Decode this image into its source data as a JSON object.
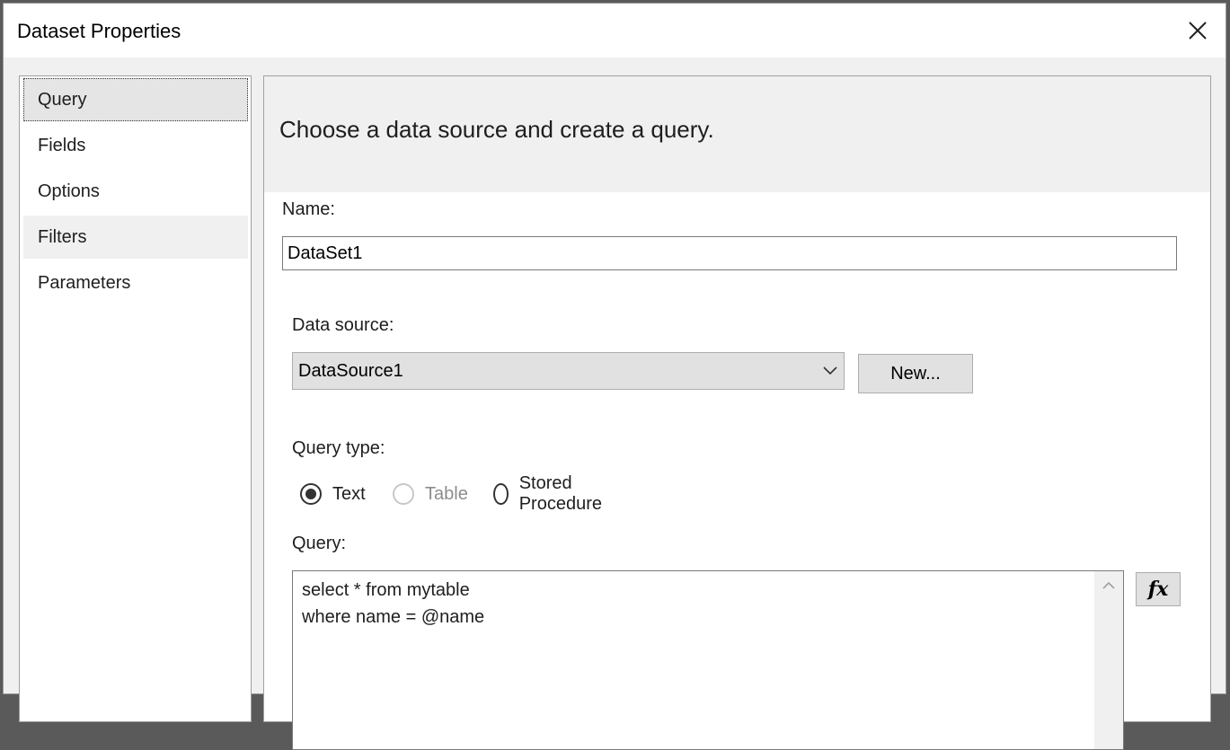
{
  "window": {
    "title": "Dataset Properties"
  },
  "nav": {
    "items": [
      {
        "label": "Query"
      },
      {
        "label": "Fields"
      },
      {
        "label": "Options"
      },
      {
        "label": "Filters"
      },
      {
        "label": "Parameters"
      }
    ],
    "selected": "Query"
  },
  "panel": {
    "heading": "Choose a data source and create a query.",
    "name_label": "Name:",
    "name_value": "DataSet1",
    "data_source_label": "Data source:",
    "data_source_value": "DataSource1",
    "new_button_label": "New...",
    "query_type_label": "Query type:",
    "query_types": [
      {
        "label": "Text",
        "checked": true,
        "enabled": true
      },
      {
        "label": "Table",
        "checked": false,
        "enabled": false
      },
      {
        "label": "Stored Procedure",
        "checked": false,
        "enabled": true
      }
    ],
    "query_label": "Query:",
    "query_text": "select * from mytable\nwhere name = @name",
    "fx_button_label": "fx"
  },
  "icons": {
    "close": "close-icon",
    "dropdown": "chevron-down-icon",
    "scroll_up": "chevron-up-icon"
  }
}
